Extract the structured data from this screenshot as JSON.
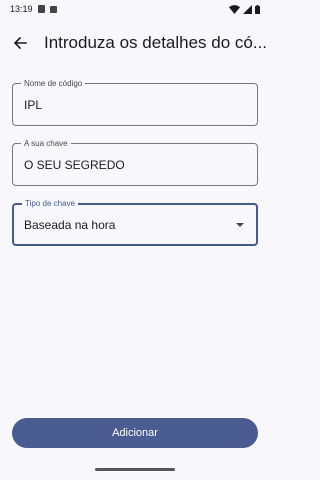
{
  "status_bar": {
    "time": "13:19",
    "icons": [
      "notification-icon",
      "sim-icon",
      "wifi-icon",
      "signal-icon",
      "battery-icon"
    ]
  },
  "app_bar": {
    "back_icon": "arrow-back-icon",
    "title": "Introduza os detalhes do có..."
  },
  "form": {
    "code_name": {
      "label": "Nome de código",
      "value": "IPL"
    },
    "key": {
      "label": "A sua chave",
      "value": "O SEU SEGREDO"
    },
    "key_type": {
      "label": "Tipo de chave",
      "value": "Baseada na hora",
      "icon": "dropdown-arrow-icon"
    }
  },
  "actions": {
    "add_label": "Adicionar"
  },
  "colors": {
    "accent": "#45598f",
    "button": "#4b5c92",
    "background": "#f8f8fc"
  }
}
